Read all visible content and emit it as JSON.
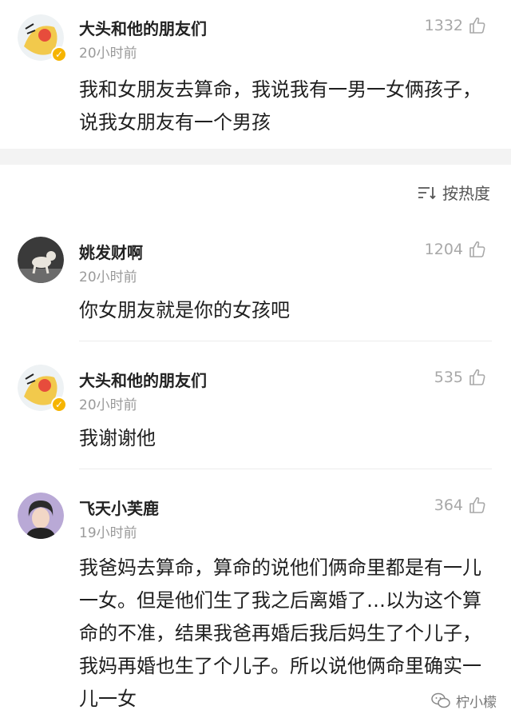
{
  "post": {
    "author": "大头和他的朋友们",
    "time": "20小时前",
    "likes": "1332",
    "content": "我和女朋友去算命，我说我有一男一女俩孩子，说我女朋友有一个男孩"
  },
  "sort": {
    "label": "按热度",
    "icon": "sort-icon"
  },
  "comments": [
    {
      "author": "姚发财啊",
      "time": "20小时前",
      "likes": "1204",
      "content": "你女朋友就是你的女孩吧"
    },
    {
      "author": "大头和他的朋友们",
      "time": "20小时前",
      "likes": "535",
      "content": "我谢谢他"
    },
    {
      "author": "飞天小芙鹿",
      "time": "19小时前",
      "likes": "364",
      "content": "我爸妈去算命，算命的说他们俩命里都是有一儿一女。但是他们生了我之后离婚了…以为这个算命的不准，结果我爸再婚后我后妈生了个儿子，我妈再婚也生了个儿子。所以说他俩命里确实一儿一女"
    }
  ],
  "watermark": {
    "text": "柠小檬"
  },
  "colors": {
    "muted": "#9a9a9a",
    "band": "#f3f3f3",
    "text": "#1f1f1f"
  }
}
